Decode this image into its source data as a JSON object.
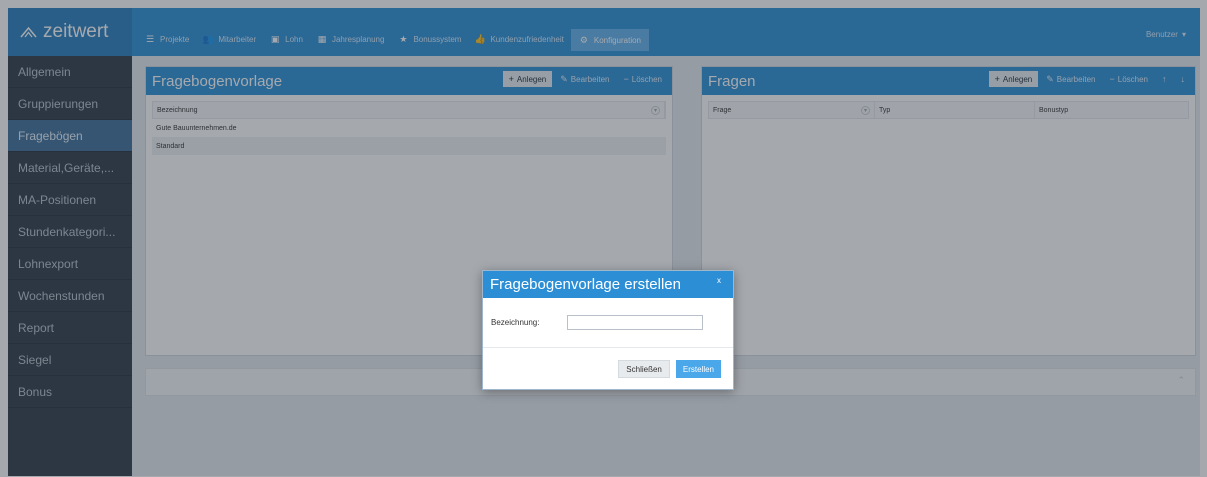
{
  "app": {
    "logo_text": "zeitwert",
    "user_label": "Benutzer"
  },
  "nav": {
    "items": [
      {
        "label": "Projekte",
        "icon": "list-icon"
      },
      {
        "label": "Mitarbeiter",
        "icon": "users-icon"
      },
      {
        "label": "Lohn",
        "icon": "money-icon"
      },
      {
        "label": "Jahresplanung",
        "icon": "calendar-icon"
      },
      {
        "label": "Bonussystem",
        "icon": "star-icon"
      },
      {
        "label": "Kundenzufriedenheit",
        "icon": "thumbs-up-icon"
      },
      {
        "label": "Konfiguration",
        "icon": "gear-icon",
        "active": true
      }
    ]
  },
  "sidebar": {
    "items": [
      {
        "label": "Allgemein"
      },
      {
        "label": "Gruppierungen"
      },
      {
        "label": "Fragebögen",
        "active": true
      },
      {
        "label": "Material,Geräte,..."
      },
      {
        "label": "MA-Positionen"
      },
      {
        "label": "Stundenkategori..."
      },
      {
        "label": "Lohnexport"
      },
      {
        "label": "Wochenstunden"
      },
      {
        "label": "Report"
      },
      {
        "label": "Siegel"
      },
      {
        "label": "Bonus"
      }
    ]
  },
  "left_panel": {
    "title": "Fragebogenvorlage",
    "actions": {
      "add": "Anlegen",
      "edit": "Bearbeiten",
      "delete": "Löschen"
    },
    "columns": [
      "Bezeichnung"
    ],
    "rows": [
      "Gute Bauunternehmen.de",
      "Standard"
    ]
  },
  "right_panel": {
    "title": "Fragen",
    "actions": {
      "add": "Anlegen",
      "edit": "Bearbeiten",
      "delete": "Löschen"
    },
    "columns": [
      "Frage",
      "Typ",
      "Bonustyp"
    ]
  },
  "modal": {
    "title": "Fragebogenvorlage erstellen",
    "close_glyph": "x",
    "field_label": "Bezeichnung:",
    "field_value": "",
    "close_button": "Schließen",
    "create_button": "Erstellen"
  },
  "colors": {
    "accent": "#2c8fd6",
    "sidebar_bg": "#2f3b48",
    "overlay": "rgba(40,50,62,0.42)"
  }
}
